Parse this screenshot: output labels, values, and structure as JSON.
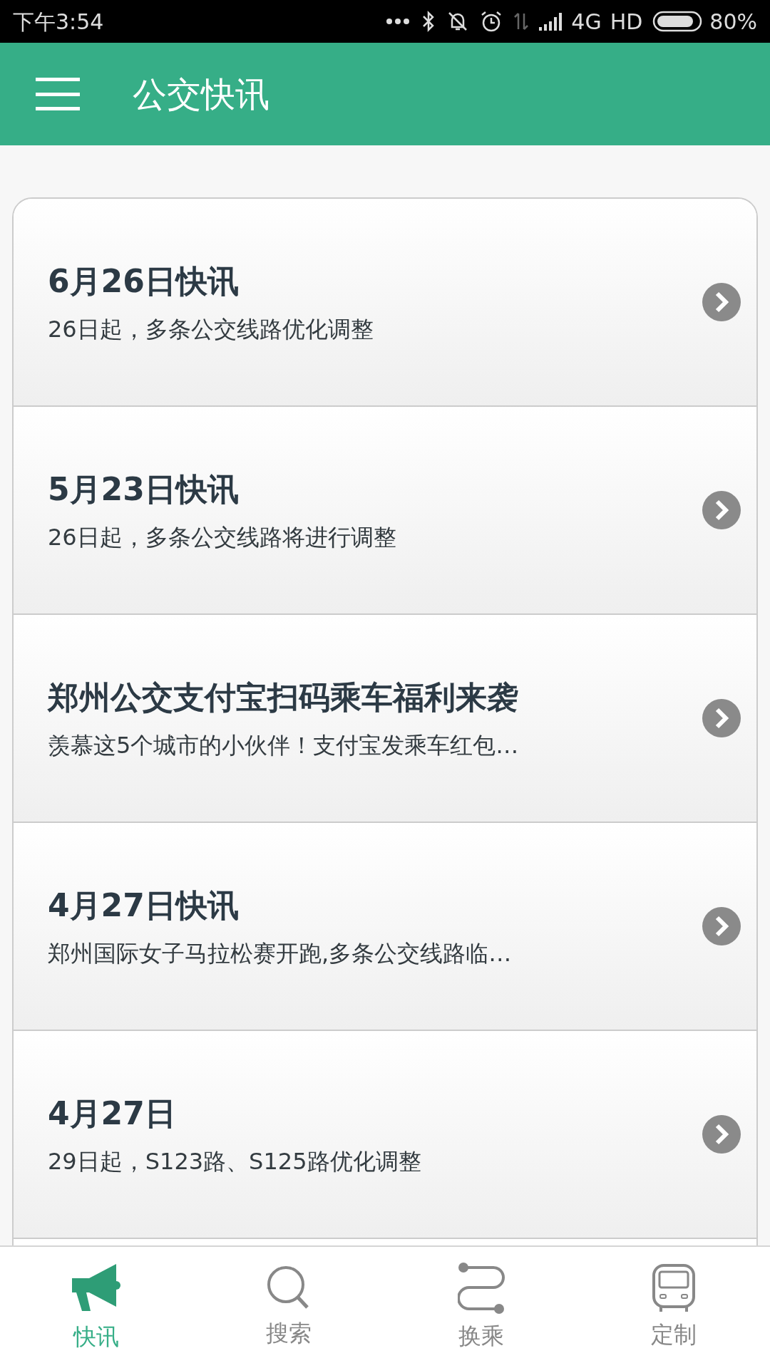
{
  "status_bar": {
    "time": "下午3:54",
    "network": "4G",
    "hd": "HD",
    "battery": "80%"
  },
  "header": {
    "title": "公交快讯"
  },
  "news": [
    {
      "title": "6月26日快讯",
      "summary": "26日起，多条公交线路优化调整"
    },
    {
      "title": "5月23日快讯",
      "summary": "26日起，多条公交线路将进行调整"
    },
    {
      "title": "郑州公交支付宝扫码乘车福利来袭",
      "summary": "羡慕这5个城市的小伙伴！支付宝发乘车红包…"
    },
    {
      "title": "4月27日快讯",
      "summary": "郑州国际女子马拉松赛开跑,多条公交线路临…"
    },
    {
      "title": "4月27日",
      "summary": "29日起，S123路、S125路优化调整"
    }
  ],
  "tabs": [
    {
      "kind": "news",
      "label": "快讯",
      "selected": true
    },
    {
      "kind": "search",
      "label": "搜索",
      "selected": false
    },
    {
      "kind": "transfer",
      "label": "换乘",
      "selected": false
    },
    {
      "kind": "custom",
      "label": "定制",
      "selected": false
    }
  ]
}
